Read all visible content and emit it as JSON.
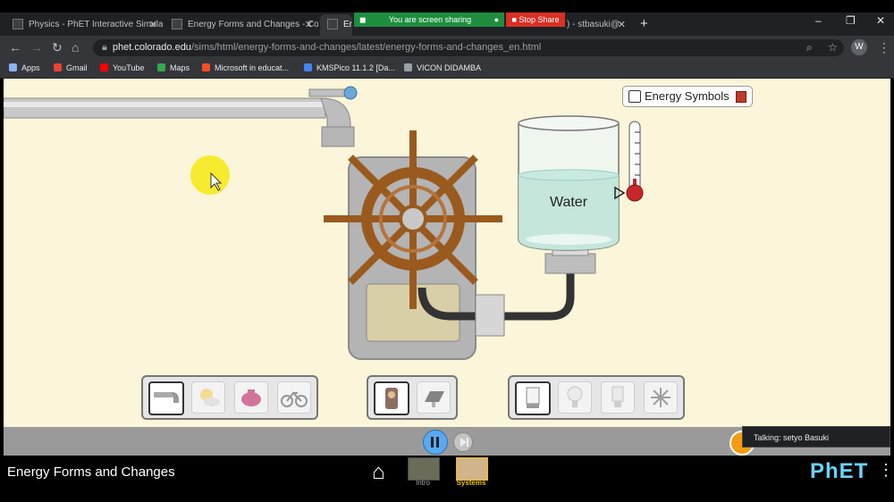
{
  "browser": {
    "tabs": [
      {
        "title": "Physics - PhET Interactive Simula"
      },
      {
        "title": "Energy Forms and Changes - Co"
      },
      {
        "title": "Energ"
      },
      {
        "title": ") - stbasuki@"
      }
    ],
    "new_tab_symbol": "+",
    "url_host": "phet.colorado.edu",
    "url_path": "/sims/html/energy-forms-and-changes/latest/energy-forms-and-changes_en.html",
    "profile_initial": "W",
    "bookmarks": [
      {
        "label": "Apps",
        "color": "#8ab4f8"
      },
      {
        "label": "Gmail",
        "color": "#ea4335"
      },
      {
        "label": "YouTube",
        "color": "#ff0000"
      },
      {
        "label": "Maps",
        "color": "#34a853"
      },
      {
        "label": "Microsoft in educat...",
        "color": "#f25022"
      },
      {
        "label": "KMSPico 11.1.2 [Da...",
        "color": "#4285f4"
      },
      {
        "label": "VICON DIDAMBA",
        "color": "#9aa0a6"
      }
    ]
  },
  "screen_share": {
    "banner": "You are screen sharing",
    "stop_label": "Stop Share",
    "talking": "Talking: setyo Basuki"
  },
  "sim": {
    "energy_symbols_label": "Energy Symbols",
    "water_label": "Water",
    "title": "Energy Forms and Changes",
    "screens": [
      {
        "label": "Intro"
      },
      {
        "label": "Systems"
      }
    ],
    "logo": "PhET",
    "colors": {
      "background": "#fbf6d9",
      "wheel": "#9a5a1e",
      "systems_label": "#f0c000",
      "logo": "#6ad2ff"
    }
  }
}
